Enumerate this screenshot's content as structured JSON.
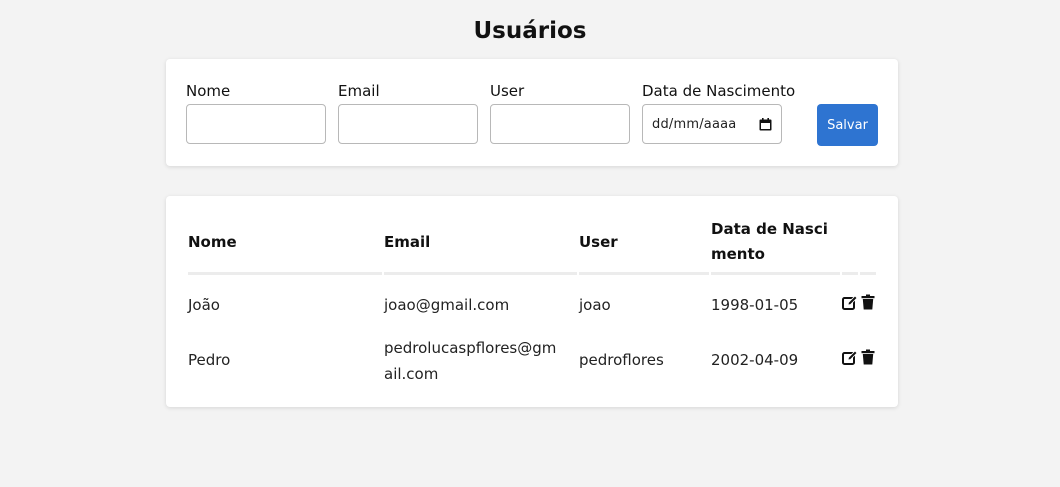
{
  "page": {
    "title": "Usuários"
  },
  "form": {
    "fields": [
      {
        "label": "Nome",
        "value": ""
      },
      {
        "label": "Email",
        "value": ""
      },
      {
        "label": "User",
        "value": ""
      },
      {
        "label": "Data de Nascimento",
        "value": "dd/mm/aaaa"
      }
    ],
    "save_label": "Salvar"
  },
  "table": {
    "headers": {
      "nome": "Nome",
      "email": "Email",
      "user": "User",
      "data_line1": "Data de Nasci",
      "data_line2": "mento"
    },
    "rows": [
      {
        "nome": "João",
        "email": "joao@gmail.com",
        "user": "joao",
        "data": "1998-01-05"
      },
      {
        "nome": "Pedro",
        "email_line1": "pedrolucaspflores@gm",
        "email_line2": "ail.com",
        "user": "pedroflores",
        "data": "2002-04-09"
      }
    ],
    "action_icons": [
      "edit-icon",
      "trash-icon"
    ]
  },
  "colors": {
    "accent": "#2e74d1",
    "background": "#f3f3f3",
    "card": "#ffffff"
  }
}
